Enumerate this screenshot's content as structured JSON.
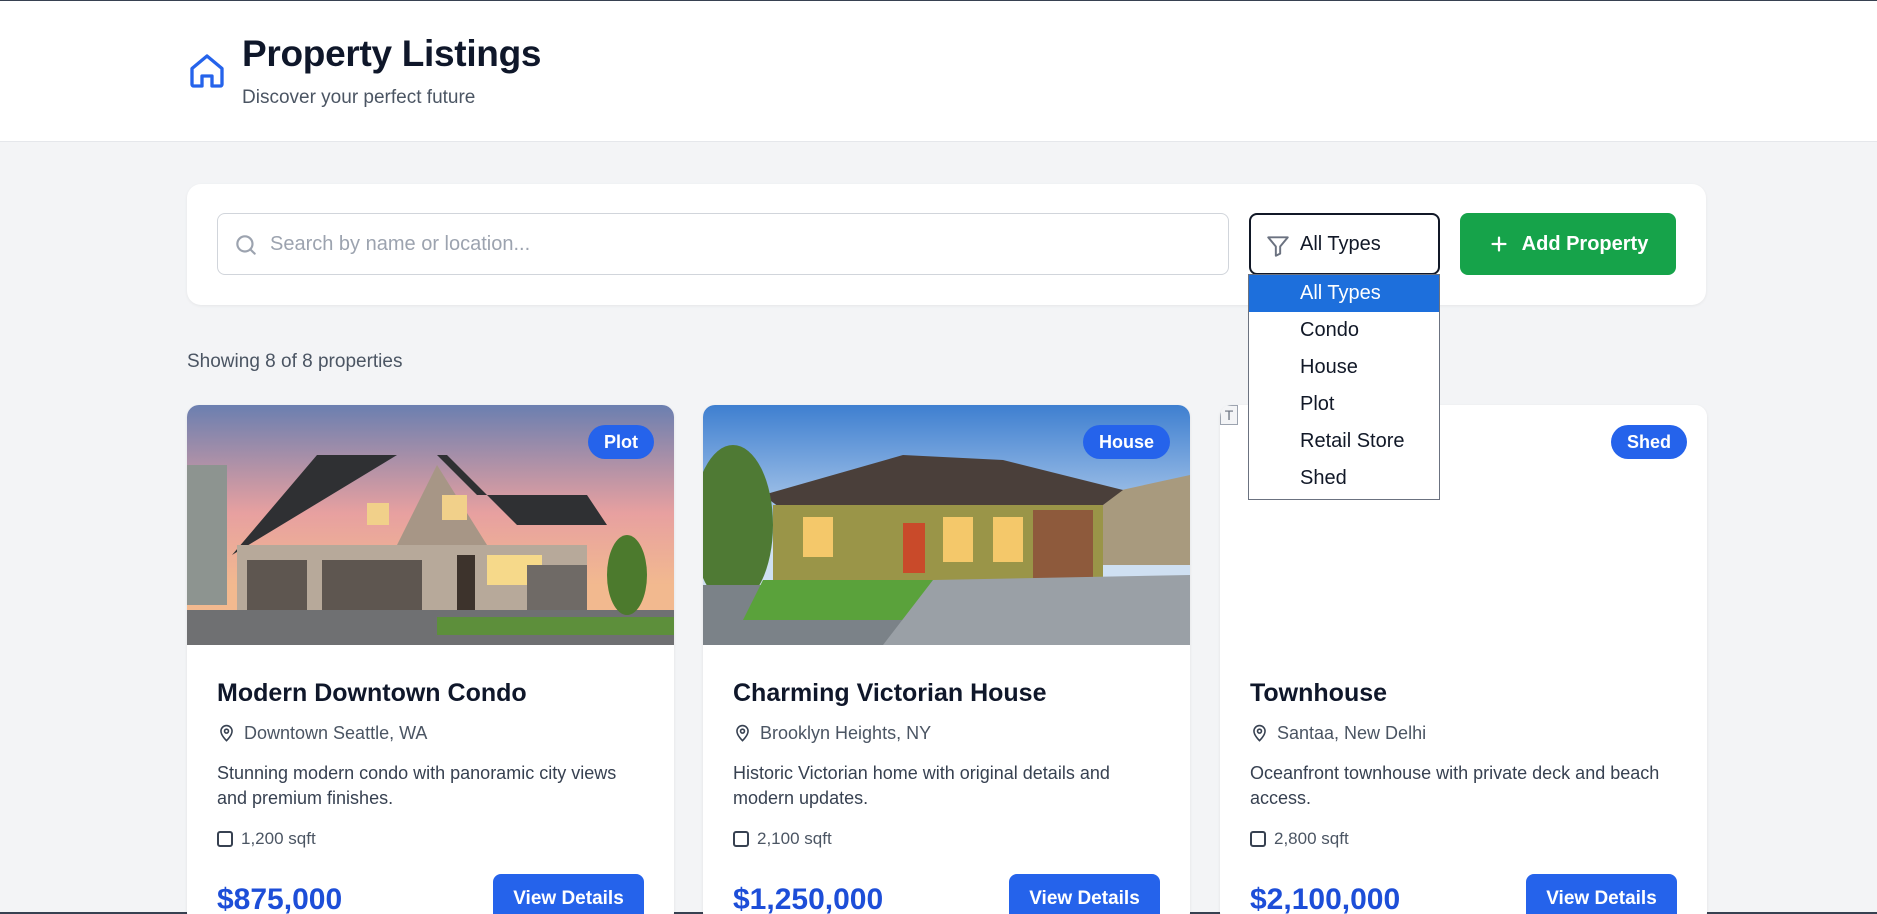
{
  "header": {
    "title": "Property Listings",
    "subtitle": "Discover your perfect future"
  },
  "toolbar": {
    "search_placeholder": "Search by name or location...",
    "search_value": "",
    "type_filter_value": "All Types",
    "add_button_label": "Add Property",
    "type_options": [
      "All Types",
      "Condo",
      "House",
      "Plot",
      "Retail Store",
      "Shed"
    ],
    "selected_option": "All Types"
  },
  "results": {
    "count_text": "Showing 8 of 8 properties"
  },
  "cards": [
    {
      "name": "Modern Downtown Condo",
      "badge": "Plot",
      "location": "Downtown Seattle, WA",
      "description": "Stunning modern condo with panoramic city views and premium finishes.",
      "area": "1,200 sqft",
      "price": "$875,000",
      "button_label": "View Details",
      "image": "house-photo-dusk"
    },
    {
      "name": "Charming Victorian House",
      "badge": "House",
      "location": "Brooklyn Heights, NY",
      "description": "Historic Victorian home with original details and modern updates.",
      "area": "2,100 sqft",
      "price": "$1,250,000",
      "button_label": "View Details",
      "image": "house-photo-day"
    },
    {
      "name": "Townhouse",
      "badge": "Shed",
      "location": "Santaa, New Delhi",
      "description": "Oceanfront townhouse with private deck and beach access.",
      "area": "2,800 sqft",
      "price": "$2,100,000",
      "button_label": "View Details",
      "image": "broken-image",
      "image_alt_fragment": "T"
    }
  ],
  "colors": {
    "primary": "#2563eb",
    "success": "#16a34a",
    "price": "#1d4ed8",
    "selected_option": "#1d6fdc"
  }
}
